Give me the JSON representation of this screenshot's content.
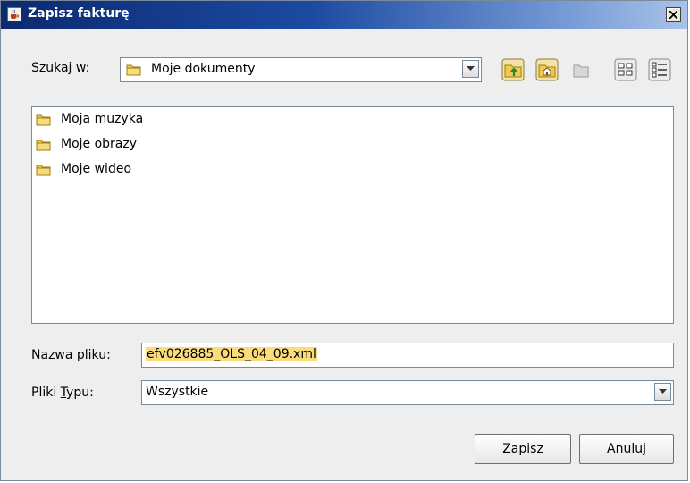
{
  "window": {
    "title": "Zapisz fakturę",
    "icon": "java-coffee-icon",
    "close_icon": "close-icon"
  },
  "look_in": {
    "label": "Szukaj w:",
    "selected": "Moje dokumenty"
  },
  "toolbar": {
    "icons": [
      "up-folder-icon",
      "home-icon",
      "new-folder-icon",
      "list-view-icon",
      "details-view-icon"
    ]
  },
  "files": [
    {
      "name": "Moja muzyka",
      "icon": "folder-icon"
    },
    {
      "name": "Moje obrazy",
      "icon": "folder-icon"
    },
    {
      "name": "Moje wideo",
      "icon": "folder-icon"
    }
  ],
  "filename": {
    "label_mnemonic": "N",
    "label_rest": "azwa pliku:",
    "value": "efv026885_OLS_04_09.xml"
  },
  "filetype": {
    "label_prefix": "Pliki ",
    "label_mnemonic": "T",
    "label_rest": "ypu:",
    "selected": "Wszystkie"
  },
  "buttons": {
    "save": "Zapisz",
    "cancel": "Anuluj"
  },
  "colors": {
    "title_start": "#0b2a6f",
    "title_end": "#a9c3ea",
    "selection": "#fbdc7a",
    "folder": "#f2c94c"
  }
}
